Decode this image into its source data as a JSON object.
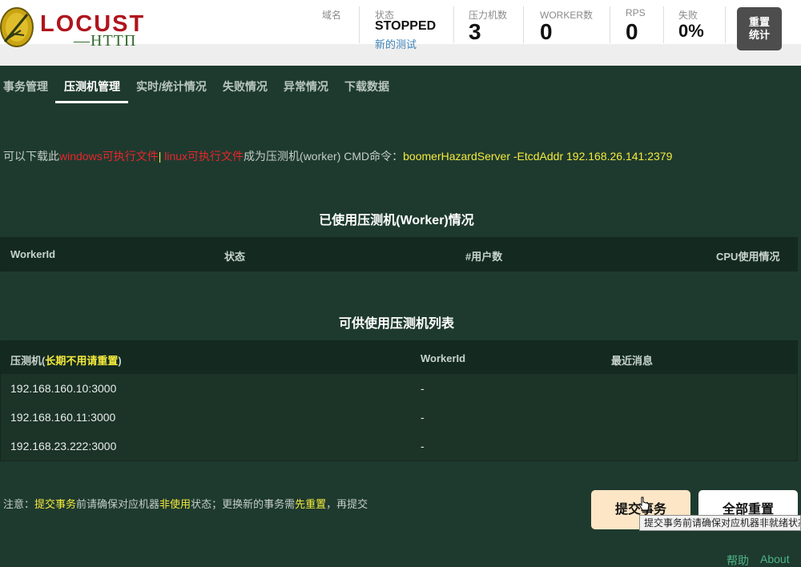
{
  "header": {
    "logo": {
      "title": "LOCUST",
      "subtitle": "—HTTП"
    },
    "host": {
      "label": "域名"
    },
    "status": {
      "label": "状态",
      "value": "STOPPED",
      "link": "新的测试"
    },
    "workers_count": {
      "label": "压力机数",
      "value": "3"
    },
    "workers": {
      "label": "WORKER数",
      "value": "0"
    },
    "rps": {
      "label": "RPS",
      "value": "0"
    },
    "failures": {
      "label": "失败",
      "value": "0%"
    },
    "reset_stats": {
      "line1": "重置",
      "line2": "统计"
    }
  },
  "tabs": [
    {
      "label": "事务管理"
    },
    {
      "label": "压测机管理"
    },
    {
      "label": "实时/统计情况"
    },
    {
      "label": "失败情况"
    },
    {
      "label": "异常情况"
    },
    {
      "label": "下载数据"
    }
  ],
  "download": {
    "prefix": "可以下载此",
    "windows_link": "windows可执行文件",
    "separator": "|",
    "linux_link": " linux可执行文件",
    "middle": "成为压测机(worker) CMD命令：",
    "command": "boomerHazardServer -EtcdAddr 192.168.26.141:2379"
  },
  "used_workers": {
    "title": "已使用压测机(Worker)情况",
    "columns": [
      "WorkerId",
      "状态",
      "#用户数",
      "CPU使用情况"
    ]
  },
  "available_workers": {
    "title": "可供使用压测机列表",
    "columns": {
      "machine_prefix": "压测机(",
      "machine_hint": "长期不用请重置",
      "machine_suffix": ")",
      "worker_id": "WorkerId",
      "last_message": "最近消息"
    },
    "rows": [
      {
        "machine": "192.168.160.10:3000",
        "worker_id": "-",
        "message": ""
      },
      {
        "machine": "192.168.160.11:3000",
        "worker_id": "-",
        "message": ""
      },
      {
        "machine": "192.168.23.222:3000",
        "worker_id": "-",
        "message": ""
      }
    ]
  },
  "note": {
    "p1": "注意：",
    "p2": "提交事务",
    "p3": "前请确保对应机器",
    "p4": "非使用",
    "p5": "状态；更换新的事务需",
    "p6": "先重置",
    "p7": "，再提交"
  },
  "buttons": {
    "submit": "提交事务",
    "reset_all": "全部重置",
    "tooltip": "提交事务前请确保对应机器非就绪状态"
  },
  "footer": {
    "help": "帮助",
    "about": "About"
  }
}
